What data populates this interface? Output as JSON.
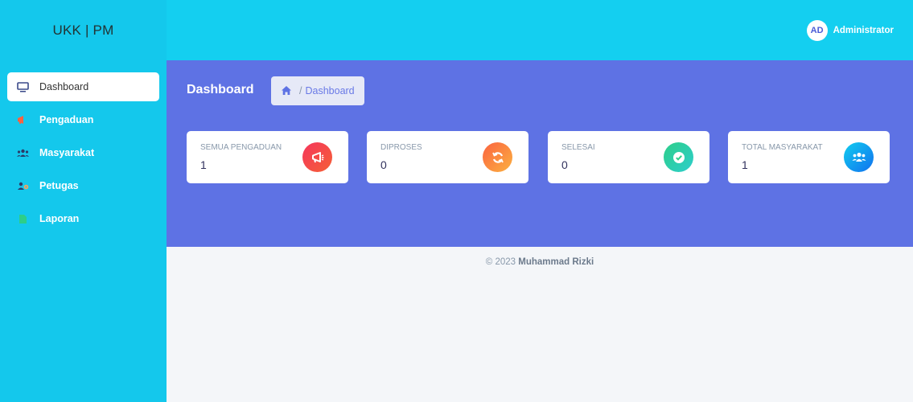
{
  "brand": "UKK | PM",
  "user": {
    "initials": "AD",
    "name": "Administrator"
  },
  "sidebar": {
    "items": [
      {
        "label": "Dashboard",
        "icon": "monitor-icon",
        "icon_color": "#5e72e4",
        "active": true
      },
      {
        "label": "Pengaduan",
        "icon": "megaphone-icon",
        "icon_color": "#fb6340"
      },
      {
        "label": "Masyarakat",
        "icon": "users-icon",
        "icon_color": "#344767"
      },
      {
        "label": "Petugas",
        "icon": "users-cog-icon",
        "icon_color": "#344767"
      },
      {
        "label": "Laporan",
        "icon": "file-icon",
        "icon_color": "#2dce89"
      }
    ]
  },
  "header": {
    "title": "Dashboard",
    "breadcrumb": {
      "separator": "/",
      "current": "Dashboard"
    }
  },
  "cards": [
    {
      "label": "SEMUA PENGADUAN",
      "value": "1",
      "icon": "megaphone-icon",
      "color": "#f5365c"
    },
    {
      "label": "DIPROSES",
      "value": "0",
      "icon": "sync-icon",
      "color": "#fb6340"
    },
    {
      "label": "SELESAI",
      "value": "0",
      "icon": "check-circle-icon",
      "color": "#2dce89"
    },
    {
      "label": "TOTAL MASYARAKAT",
      "value": "1",
      "icon": "users-icon",
      "color": "#11cdef"
    }
  ],
  "footer": {
    "prefix": "© 2023",
    "author": "Muhammad Rizki"
  }
}
